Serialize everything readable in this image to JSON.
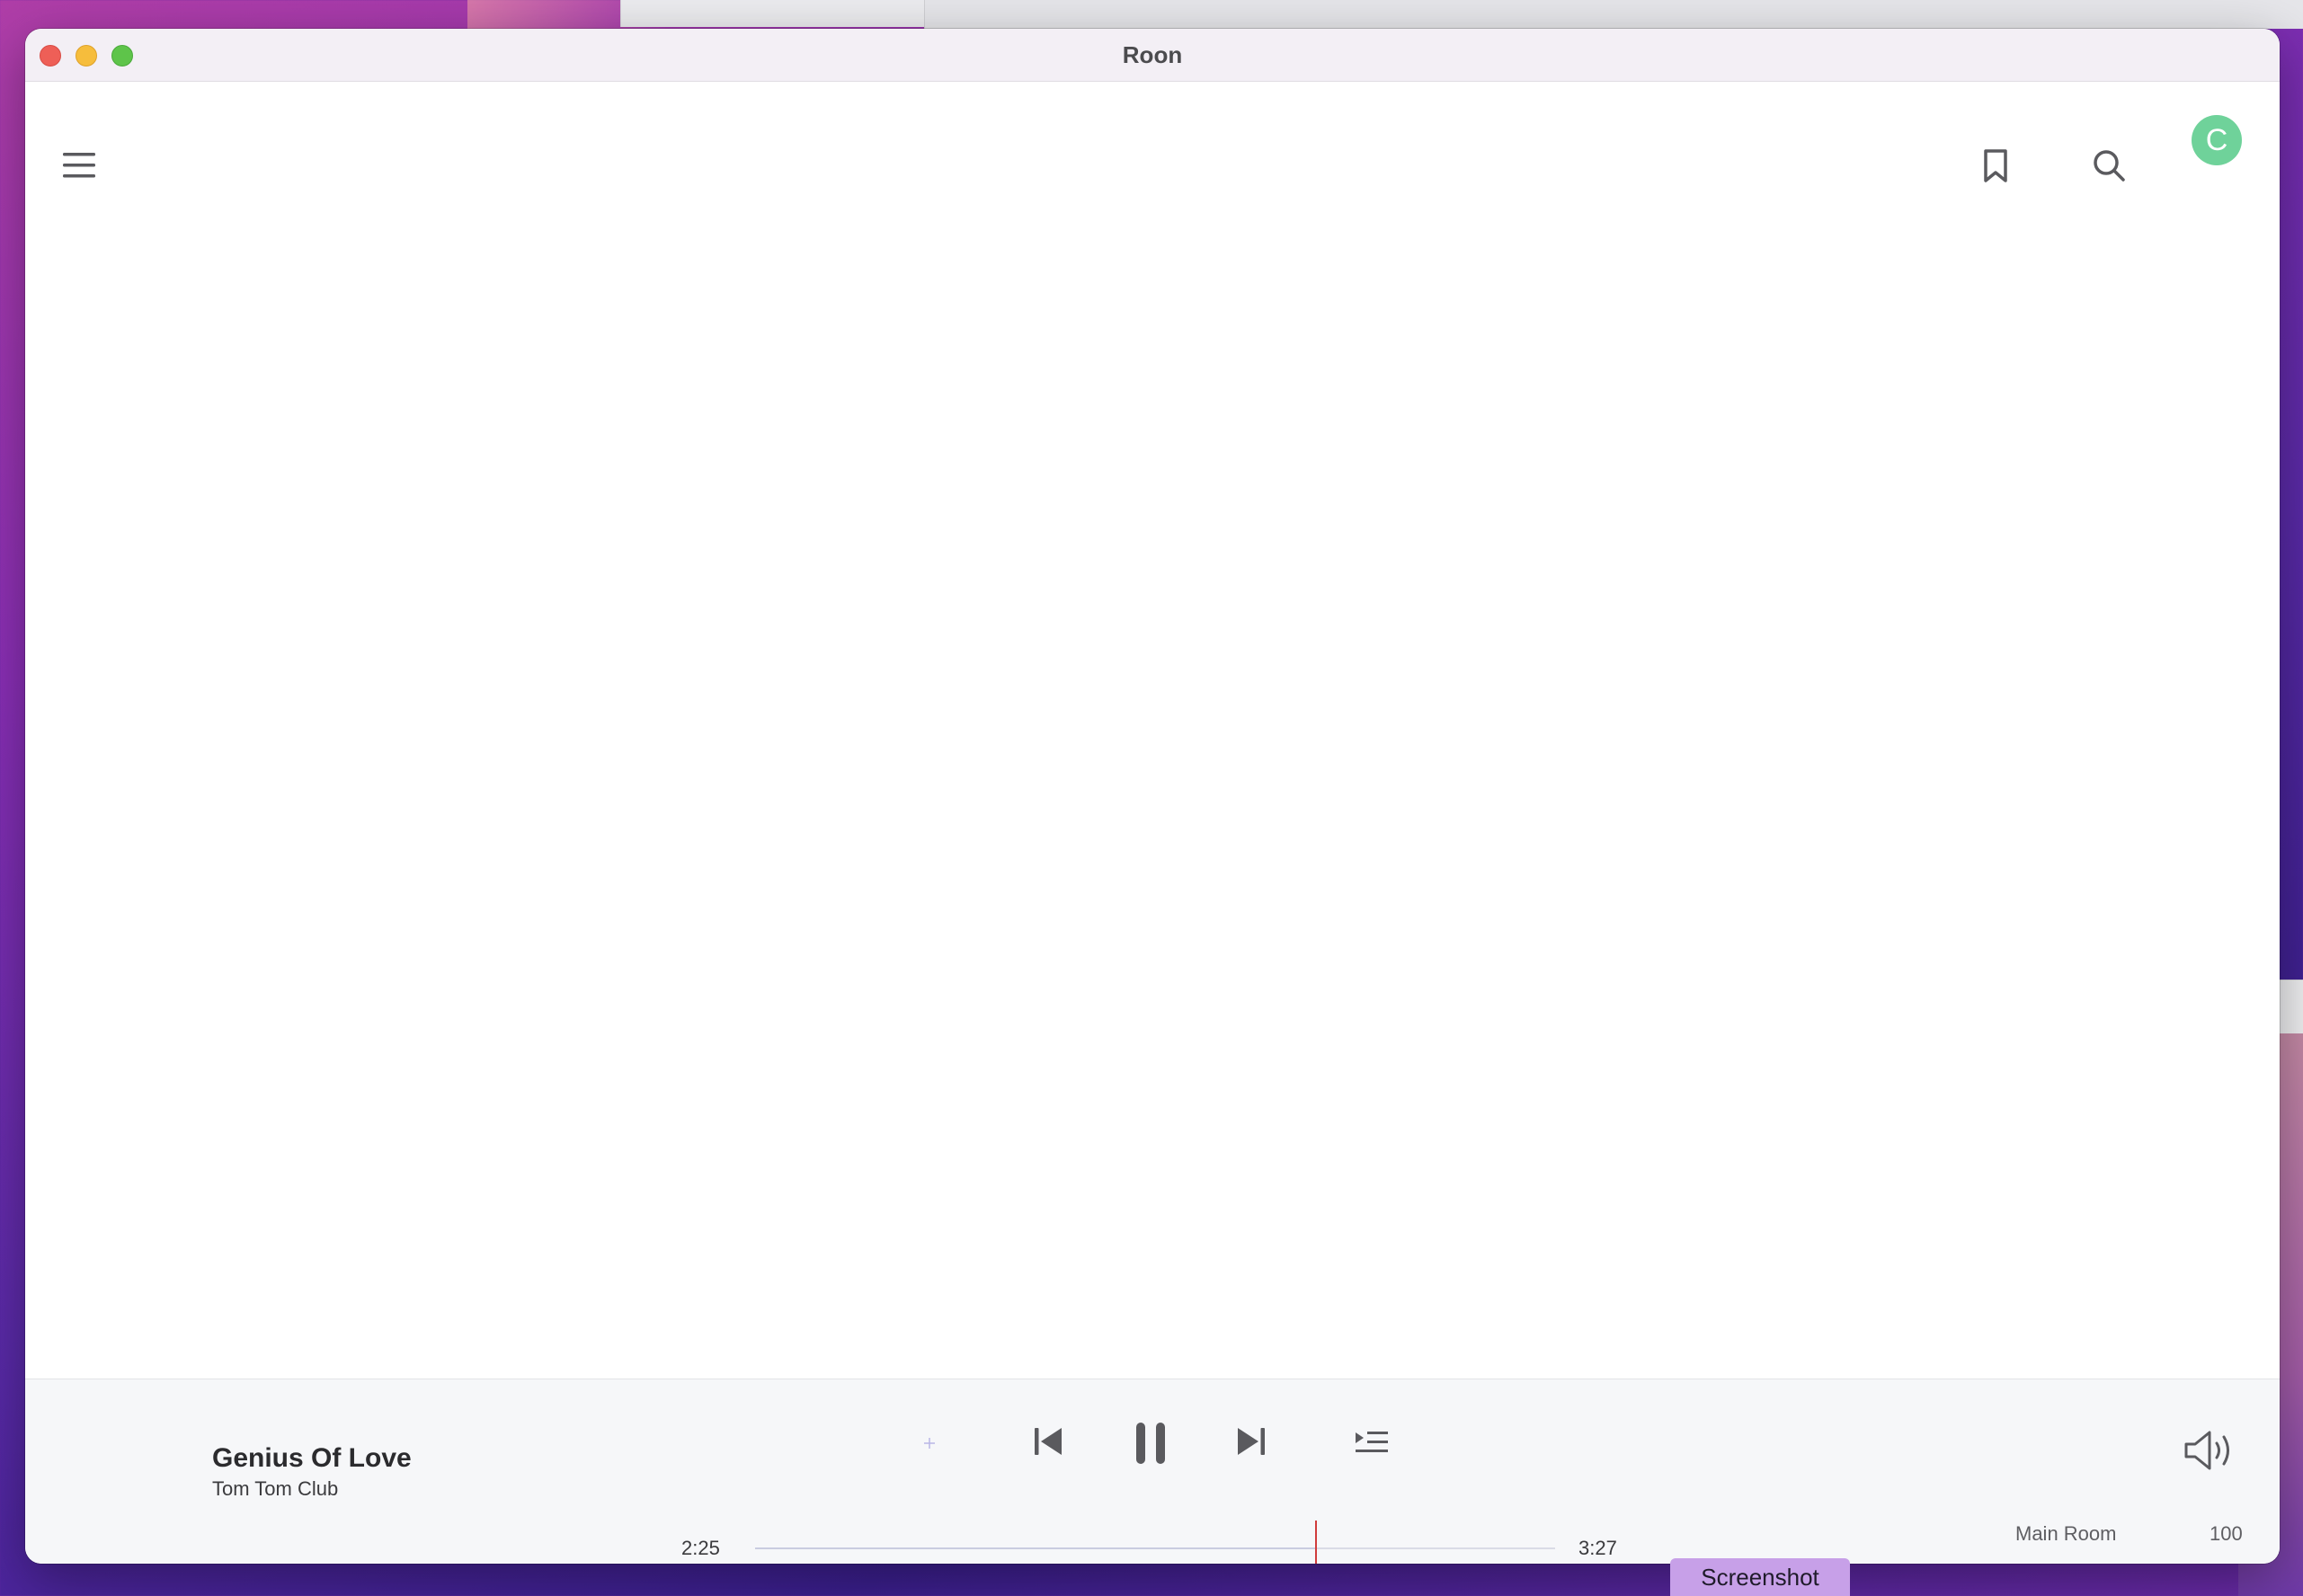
{
  "window": {
    "title": "Roon"
  },
  "header": {
    "avatar_initial": "C"
  },
  "now_playing": {
    "title": "Genius Of Love",
    "artist": "Tom Tom Club",
    "elapsed": "2:25",
    "duration": "3:27",
    "progress_fraction": 0.7
  },
  "zone": {
    "name": "Main Room",
    "volume": "100"
  },
  "screenshot_tooltip": {
    "label": "Screenshot"
  },
  "colors": {
    "avatar": "#6fd29a",
    "progress_marker": "#d03c3c",
    "tooltip": "#c7a0e8"
  },
  "icons": {
    "menu": "hamburger-menu-icon",
    "bookmark": "bookmark-icon",
    "search": "search-icon",
    "previous": "skip-previous-icon",
    "pause": "pause-icon",
    "next": "skip-next-icon",
    "queue": "queue-icon",
    "volume": "speaker-volume-icon"
  }
}
